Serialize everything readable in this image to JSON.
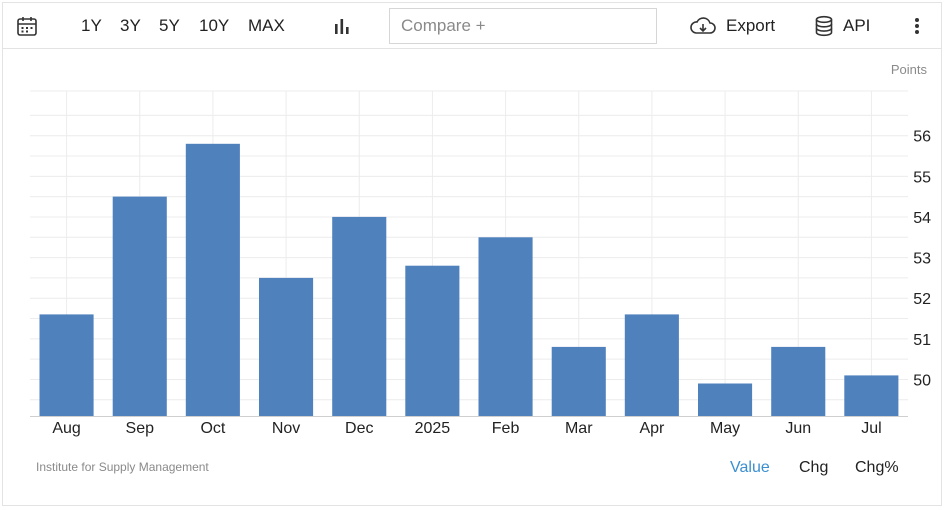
{
  "toolbar": {
    "calendar_icon": "calendar-icon",
    "ranges": [
      "1Y",
      "3Y",
      "5Y",
      "10Y",
      "MAX"
    ],
    "chart_type_icon": "bar-chart-icon",
    "compare_placeholder": "Compare +",
    "export_label": "Export",
    "export_icon": "cloud-download-icon",
    "api_label": "API",
    "api_icon": "database-icon",
    "more_icon": "more-vertical-icon"
  },
  "units_label": "Points",
  "source": "Institute for Supply Management",
  "view_tabs": [
    "Value",
    "Chg",
    "Chg%"
  ],
  "active_tab": "Value",
  "colors": {
    "bar": "#4f81bd",
    "accent": "#3b8fd1",
    "grid": "#ececec"
  },
  "chart_data": {
    "type": "bar",
    "categories": [
      "Aug",
      "Sep",
      "Oct",
      "Nov",
      "Dec",
      "2025",
      "Feb",
      "Mar",
      "Apr",
      "May",
      "Jun",
      "Jul"
    ],
    "values": [
      51.6,
      54.5,
      55.8,
      52.5,
      54.0,
      52.8,
      53.5,
      50.8,
      51.6,
      49.9,
      50.8,
      50.1
    ],
    "yticks": [
      50,
      51,
      52,
      53,
      54,
      55,
      56
    ],
    "ylim": [
      49.1,
      57.1
    ],
    "y_axis_position": "right",
    "grid": true,
    "title": "",
    "xlabel": "",
    "ylabel": ""
  }
}
